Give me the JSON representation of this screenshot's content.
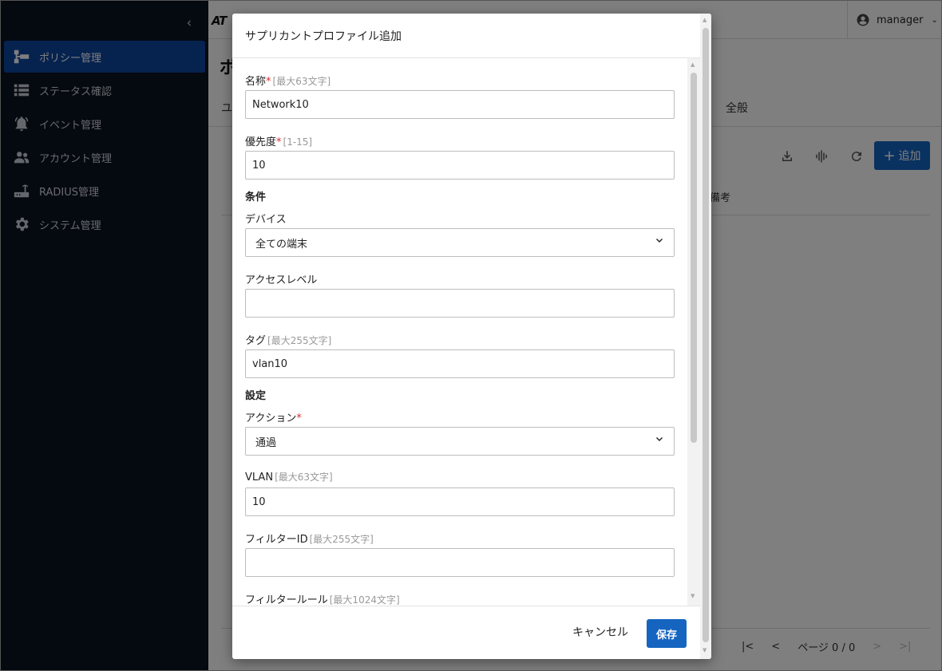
{
  "sidebar": {
    "items": [
      {
        "label": "ポリシー管理",
        "icon": "policy-tree-icon",
        "active": true
      },
      {
        "label": "ステータス確認",
        "icon": "list-icon",
        "active": false
      },
      {
        "label": "イベント管理",
        "icon": "bell-icon",
        "active": false
      },
      {
        "label": "アカウント管理",
        "icon": "people-icon",
        "active": false
      },
      {
        "label": "RADIUS管理",
        "icon": "router-icon",
        "active": false
      },
      {
        "label": "システム管理",
        "icon": "gear-icon",
        "active": false
      }
    ]
  },
  "header": {
    "logo": "AT",
    "user": "manager"
  },
  "page": {
    "title": "ポ",
    "tab_left": "ユ",
    "tab_general": "全般",
    "add_label": "追加",
    "column_remark": "備考",
    "pager": {
      "label": "ページ 0 / 0"
    }
  },
  "modal": {
    "title": "サプリカントプロファイル追加",
    "fields": {
      "name": {
        "label": "名称",
        "required": "*",
        "hint": "[最大63文字]",
        "value": "Network10"
      },
      "priority": {
        "label": "優先度",
        "required": "*",
        "hint": "[1-15]",
        "value": "10"
      },
      "section_condition": "条件",
      "device": {
        "label": "デバイス",
        "value": "全ての端末"
      },
      "access_level": {
        "label": "アクセスレベル",
        "value": ""
      },
      "tag": {
        "label": "タグ",
        "hint": "[最大255文字]",
        "value": "vlan10"
      },
      "section_settings": "設定",
      "action": {
        "label": "アクション",
        "required": "*",
        "value": "通過"
      },
      "vlan": {
        "label": "VLAN",
        "hint": "[最大63文字]",
        "value": "10"
      },
      "filter_id": {
        "label": "フィルターID",
        "hint": "[最大255文字]",
        "value": ""
      },
      "filter_rule": {
        "label": "フィルタールール",
        "hint": "[最大1024文字]"
      }
    },
    "cancel_label": "キャンセル",
    "save_label": "保存"
  },
  "colors": {
    "sidebar_bg": "#0b1320",
    "active_nav": "#0d47a1",
    "primary": "#1565c0",
    "required": "#d32f2f"
  }
}
